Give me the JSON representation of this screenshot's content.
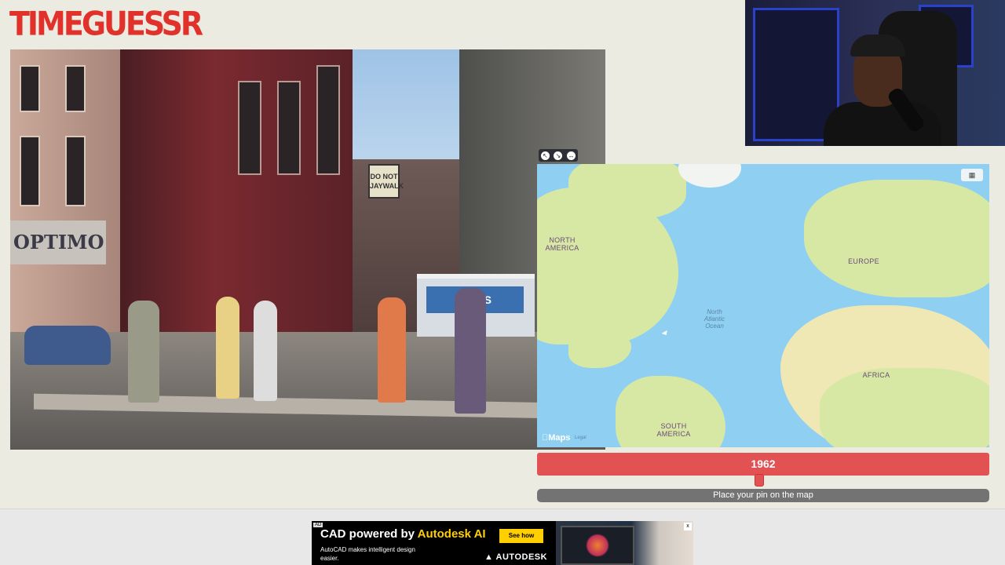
{
  "app": {
    "logo": "TIMEGUESSR"
  },
  "photo": {
    "signs": {
      "optimo": "OPTIMO",
      "jaywalk": "DO NOT JAYWALK",
      "newsstand": "NEWS"
    }
  },
  "map": {
    "labels": {
      "north_america": "NORTH AMERICA",
      "europe": "EUROPE",
      "africa": "AFRICA",
      "south_america": "SOUTH AMERICA",
      "atlantic": "North Atlantic Ocean"
    },
    "attribution": {
      "maps": "Maps",
      "legal": "Legal"
    },
    "colors": {
      "water": "#8fd0f2",
      "land": "#d7e8a5"
    }
  },
  "guess": {
    "year": "1962",
    "place_pin_prompt": "Place your pin on the map",
    "accent_color": "#e25253"
  },
  "ad": {
    "tag": "AD",
    "headline_prefix": "CAD powered by ",
    "headline_brand": "Autodesk AI",
    "subtext": "AutoCAD makes intelligent design easier.",
    "cta": "See how",
    "logo": "AUTODESK",
    "close": "x"
  }
}
